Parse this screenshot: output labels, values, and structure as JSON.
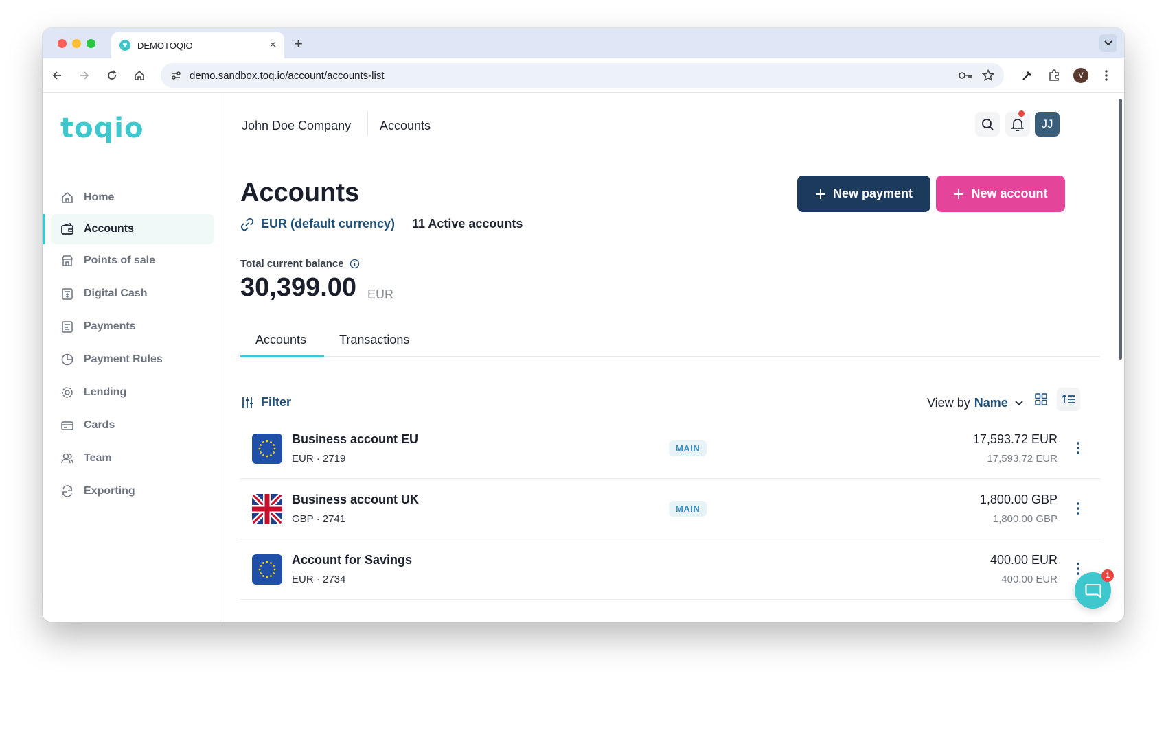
{
  "browser": {
    "tab_title": "DEMOTOQIO",
    "tab_close": "×",
    "new_tab": "+",
    "url": "demo.sandbox.toq.io/account/accounts-list",
    "profile_initial": "V"
  },
  "app": {
    "logo": "toqio",
    "brand_color": "#3ec7cc",
    "sidebar": {
      "items": [
        {
          "label": "Home",
          "icon": "home-icon"
        },
        {
          "label": "Accounts",
          "icon": "wallet-icon",
          "active": true
        },
        {
          "label": "Points of sale",
          "icon": "store-icon"
        },
        {
          "label": "Digital Cash",
          "icon": "digital-cash-icon"
        },
        {
          "label": "Payments",
          "icon": "payments-icon"
        },
        {
          "label": "Payment Rules",
          "icon": "pie-icon"
        },
        {
          "label": "Lending",
          "icon": "lending-icon"
        },
        {
          "label": "Cards",
          "icon": "card-icon"
        },
        {
          "label": "Team",
          "icon": "team-icon"
        },
        {
          "label": "Exporting",
          "icon": "refresh-icon"
        }
      ]
    },
    "header": {
      "company": "John Doe Company",
      "page": "Accounts",
      "avatar_initials": "JJ"
    },
    "main": {
      "title": "Accounts",
      "currency_link": "EUR (default currency)",
      "active_accounts": "11 Active accounts",
      "new_payment_label": "New payment",
      "new_account_label": "New account",
      "balance_label": "Total current balance",
      "balance_value": "30,399.00",
      "balance_currency": "EUR",
      "tabs": [
        {
          "label": "Accounts",
          "active": true
        },
        {
          "label": "Transactions",
          "active": false
        }
      ],
      "filter_label": "Filter",
      "view_by_prefix": "View by",
      "view_by_value": "Name",
      "accounts": [
        {
          "name": "Business account EU",
          "sub": "EUR · 2719",
          "badge": "MAIN",
          "amount": "17,593.72 EUR",
          "amount_secondary": "17,593.72 EUR",
          "flag": "eu"
        },
        {
          "name": "Business account UK",
          "sub": "GBP · 2741",
          "badge": "MAIN",
          "amount": "1,800.00 GBP",
          "amount_secondary": "1,800.00 GBP",
          "flag": "uk"
        },
        {
          "name": "Account for Savings",
          "sub": "EUR · 2734",
          "badge": "",
          "amount": "400.00 EUR",
          "amount_secondary": "400.00 EUR",
          "flag": "eu"
        }
      ]
    },
    "chat_badge": "1"
  }
}
